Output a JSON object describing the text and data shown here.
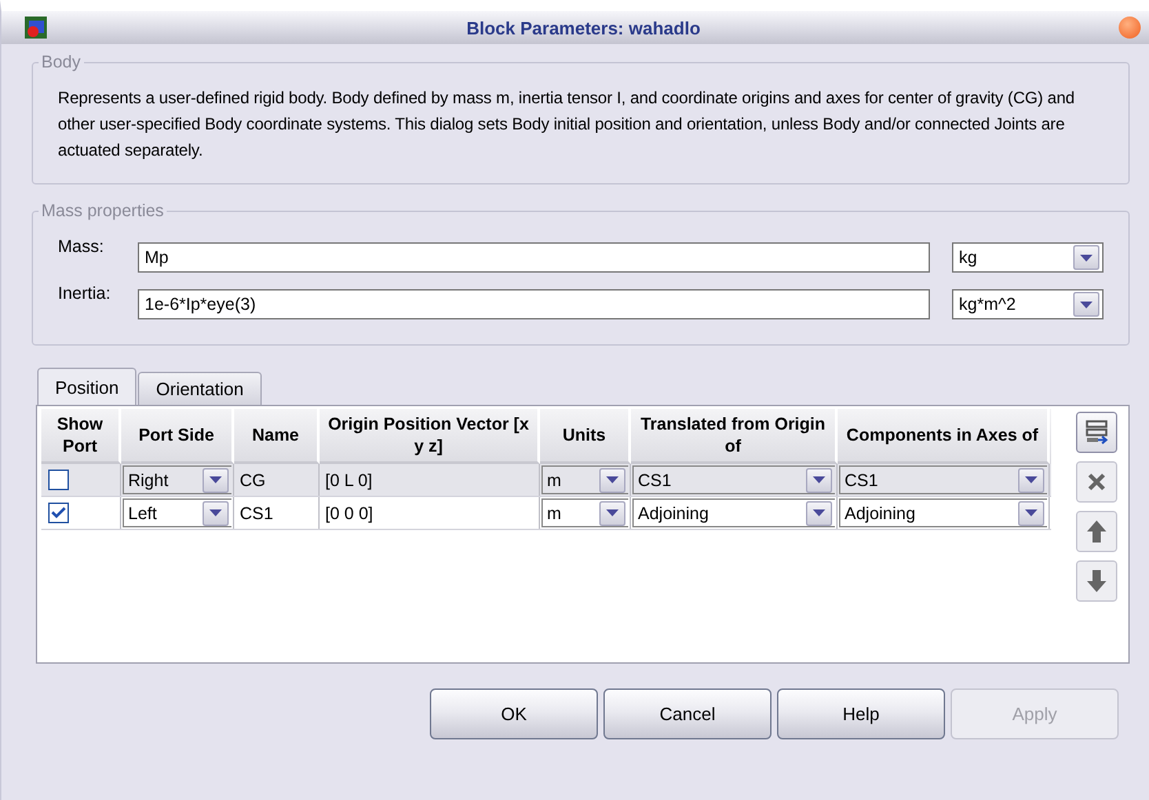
{
  "window": {
    "title": "Block Parameters: wahadlo"
  },
  "body_group": {
    "title": "Body",
    "description": "Represents a user-defined rigid body. Body defined by mass m, inertia tensor I, and coordinate origins and axes for center of gravity (CG) and other user-specified Body coordinate systems. This dialog sets Body initial position and orientation, unless Body and/or connected Joints are actuated separately."
  },
  "mass_group": {
    "title": "Mass properties",
    "fields": [
      {
        "label": "Mass:",
        "value": "Mp",
        "unit": "kg"
      },
      {
        "label": "Inertia:",
        "value": "1e-6*Ip*eye(3)",
        "unit": "kg*m^2"
      }
    ]
  },
  "tabs": [
    {
      "label": "Position",
      "selected": true
    },
    {
      "label": "Orientation",
      "selected": false
    }
  ],
  "table": {
    "columns": [
      "Show Port",
      "Port Side",
      "Name",
      "Origin Position Vector [x y z]",
      "Units",
      "Translated from Origin of",
      "Components in Axes of"
    ],
    "rows": [
      {
        "selected": true,
        "show_port": false,
        "port_side": "Right",
        "name": "CG",
        "origin": "[0 L 0]",
        "units": "m",
        "translated_from": "CS1",
        "components_in": "CS1"
      },
      {
        "selected": false,
        "show_port": true,
        "port_side": "Left",
        "name": "CS1",
        "origin": "[0 0 0]",
        "units": "m",
        "translated_from": "Adjoining",
        "components_in": "Adjoining"
      }
    ]
  },
  "side_buttons": [
    {
      "kind": "add",
      "disabled": false
    },
    {
      "kind": "delete",
      "disabled": true
    },
    {
      "kind": "up",
      "disabled": true
    },
    {
      "kind": "down",
      "disabled": true
    }
  ],
  "buttons": [
    {
      "label": "OK",
      "disabled": false
    },
    {
      "label": "Cancel",
      "disabled": false
    },
    {
      "label": "Help",
      "disabled": false
    },
    {
      "label": "Apply",
      "disabled": true
    }
  ]
}
